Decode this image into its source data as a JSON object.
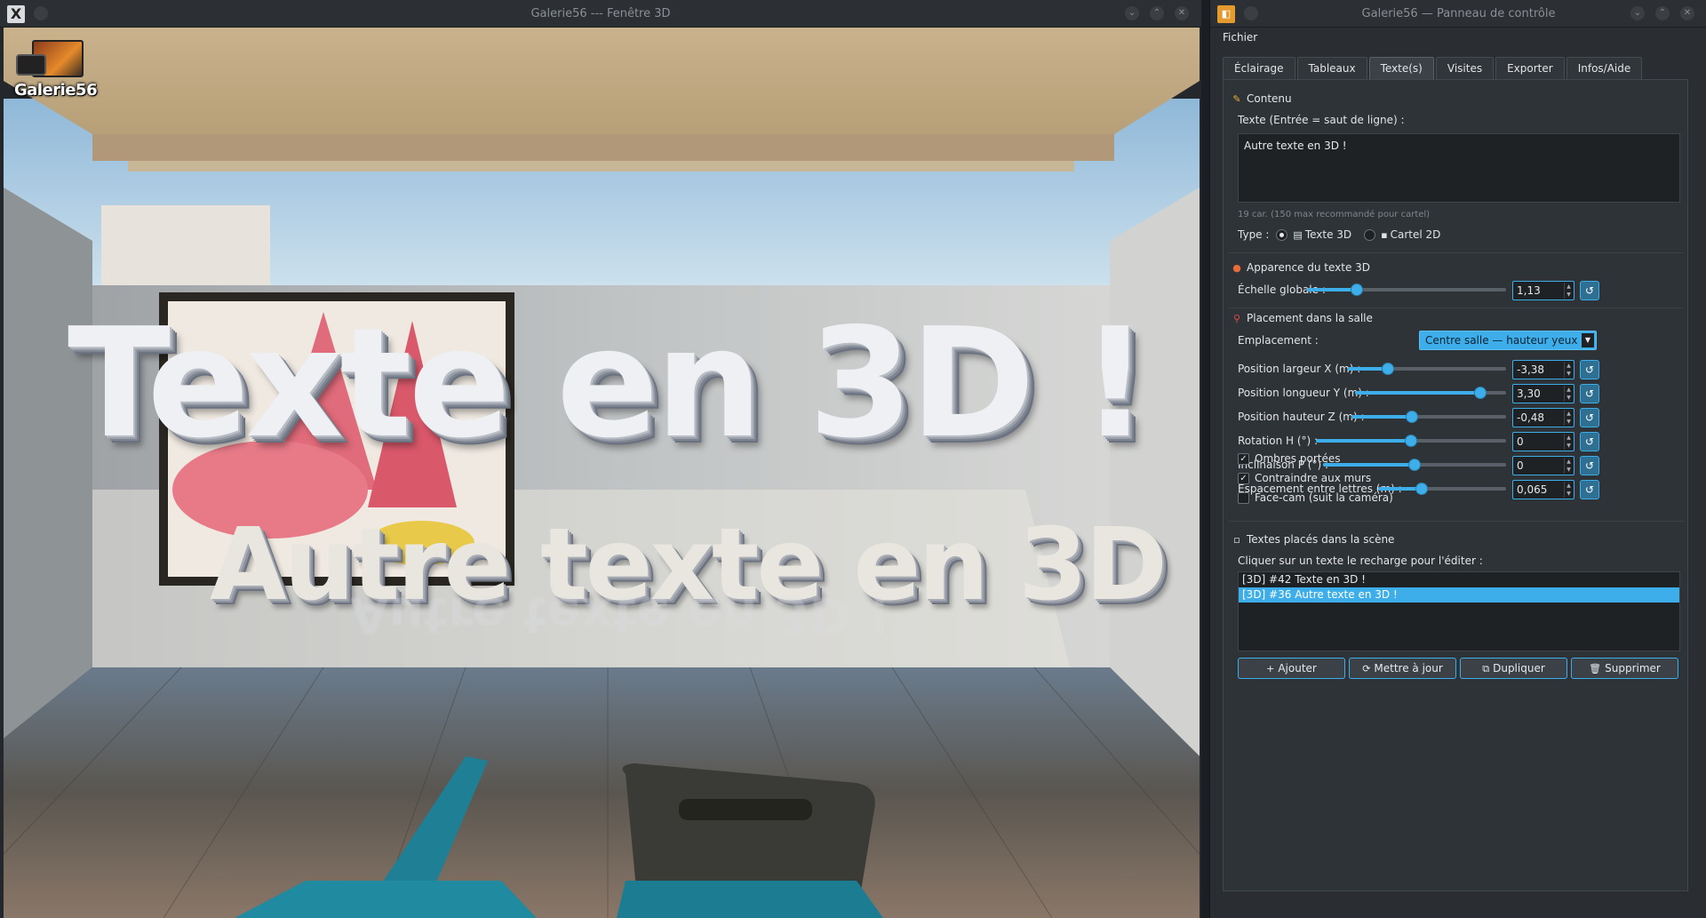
{
  "window3d": {
    "title": "Galerie56 --- Fenêtre 3D",
    "logo_text": "Galerie56",
    "scene_text_main": "Texte en 3D !",
    "scene_text_second": "Autre texte en 3D !"
  },
  "panel": {
    "title": "Galerie56 — Panneau de contrôle",
    "menu": {
      "file": "Fichier"
    },
    "tabs": [
      "Éclairage",
      "Tableaux",
      "Texte(s)",
      "Visites",
      "Exporter",
      "Infos/Aide"
    ],
    "active_tab": "Texte(s)",
    "content": {
      "header": "Contenu",
      "text_label": "Texte (Entrée = saut de ligne) :",
      "text_value": "Autre texte en 3D !",
      "char_hint": "19 car. (150 max recommandé pour cartel)",
      "type_label": "Type :",
      "type_3d": "Texte 3D",
      "type_2d": "Cartel 2D",
      "type_selected": "Texte 3D"
    },
    "appearance": {
      "header": "Apparence du texte 3D",
      "scale_label": "Échelle globale :",
      "scale_value": "1,13",
      "scale_level": 0.25
    },
    "placement": {
      "header": "Placement dans la salle",
      "location_label": "Emplacement :",
      "location_value": "Centre salle — hauteur yeux",
      "fields": [
        {
          "label": "Position largeur X (m) :",
          "value": "-3,38",
          "level": 0.25
        },
        {
          "label": "Position longueur Y (m) :",
          "value": "3,30",
          "level": 0.83
        },
        {
          "label": "Position hauteur Z (m) :",
          "value": "-0,48",
          "level": 0.39
        },
        {
          "label": "Rotation H (°) :",
          "value": "0",
          "level": 0.5
        },
        {
          "label": "Inclinaison P (°) :",
          "value": "0",
          "level": 0.5
        },
        {
          "label": "Espacement entre lettres (m) :",
          "value": "0,065",
          "level": 0.34
        }
      ],
      "checks": [
        {
          "label": "Ombres portées",
          "checked": true
        },
        {
          "label": "Contraindre aux murs",
          "checked": true
        },
        {
          "label": "Face-cam (suit la caméra)",
          "checked": false
        }
      ]
    },
    "placed": {
      "header": "Textes placés dans la scène",
      "hint": "Cliquer sur un texte le recharge pour l'éditer :",
      "items": [
        {
          "label": "[3D] #42  Texte en 3D !",
          "selected": false
        },
        {
          "label": "[3D] #36  Autre texte en 3D !",
          "selected": true
        }
      ]
    },
    "buttons": {
      "add": "Ajouter",
      "update": "Mettre à jour",
      "duplicate": "Dupliquer",
      "delete": "Supprimer"
    }
  }
}
